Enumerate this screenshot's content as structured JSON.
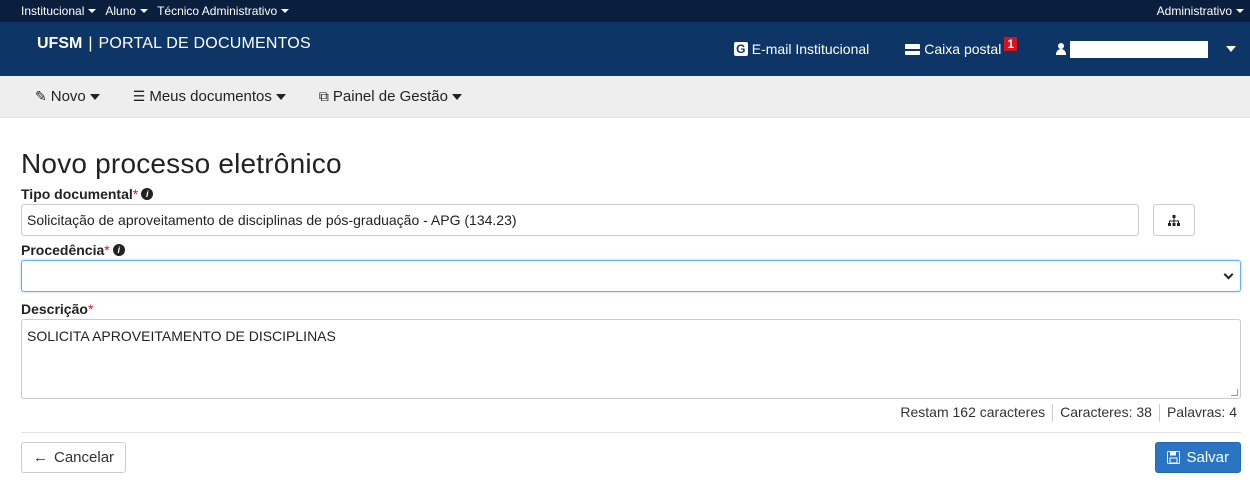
{
  "topbar": {
    "links": [
      "Institucional",
      "Aluno",
      "Técnico Administrativo"
    ],
    "right": "Administrativo"
  },
  "brand": {
    "ufsm": "UFSM",
    "separator": "|",
    "portal": "PORTAL DE DOCUMENTOS"
  },
  "header": {
    "email_label": "E-mail Institucional",
    "email_icon_letter": "G",
    "mailbox_label": "Caixa postal",
    "mailbox_count": "1"
  },
  "nav": {
    "items": [
      {
        "label": "Novo",
        "icon": "pencil-icon"
      },
      {
        "label": "Meus documentos",
        "icon": "list-icon"
      },
      {
        "label": "Painel de Gestão",
        "icon": "copy-icon"
      }
    ]
  },
  "page": {
    "title": "Novo processo eletrônico"
  },
  "form": {
    "tipo": {
      "label": "Tipo documental",
      "required": "*",
      "value": "Solicitação de aproveitamento de disciplinas de pós-graduação - APG (134.23)"
    },
    "procedencia": {
      "label": "Procedência",
      "required": "*",
      "value": ""
    },
    "descricao": {
      "label": "Descrição",
      "required": "*",
      "value": "SOLICITA APROVEITAMENTO DE DISCIPLINAS"
    },
    "counters": {
      "remaining": "Restam 162 caracteres",
      "chars": "Caracteres: 38",
      "words": "Palavras: 4"
    }
  },
  "actions": {
    "cancel": "Cancelar",
    "save": "Salvar"
  },
  "colors": {
    "topbar": "#0a1f3d",
    "brandbar": "#0d3566",
    "primary": "#2a74c4",
    "badge": "#d9131d"
  }
}
